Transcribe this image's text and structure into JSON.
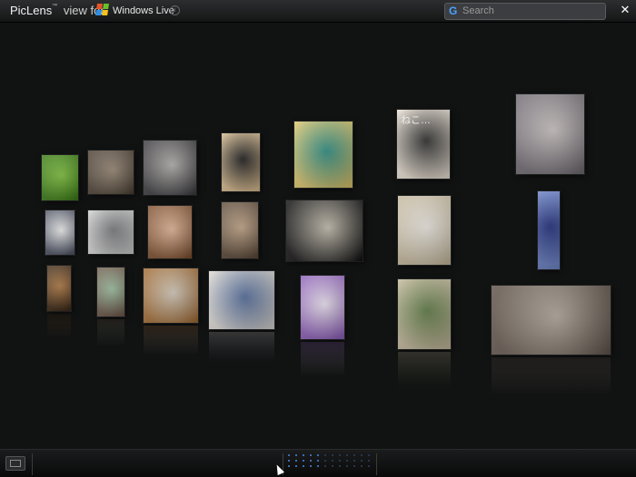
{
  "header": {
    "brand": "PicLens",
    "trademark": "™",
    "view_for": "view for",
    "provider_label": "Windows Live",
    "info_icon": "info-icon",
    "close_label": "✕"
  },
  "search": {
    "placeholder": "Search",
    "value": ""
  },
  "wall": {
    "captions": {
      "neko": "ねこ…"
    },
    "tiles": [
      {
        "id": "t1",
        "icon": "cat-on-grass-photo",
        "colors": [
          "#7fc33c",
          "#3a7a17"
        ]
      },
      {
        "id": "t2",
        "icon": "sleeping-kittens-photo",
        "colors": [
          "#9a8a77",
          "#4a3f33"
        ]
      },
      {
        "id": "t3",
        "icon": "tabby-cat-photo",
        "colors": [
          "#b7b4b0",
          "#3b3a3e"
        ]
      },
      {
        "id": "t4",
        "icon": "anime-text-screenshot",
        "colors": [
          "#1a1a1a",
          "#d5b98e"
        ]
      },
      {
        "id": "t5",
        "icon": "cartoon-cat-drawing",
        "colors": [
          "#2c8f85",
          "#d9c36b"
        ]
      },
      {
        "id": "t6",
        "icon": "neko-kitten-photo",
        "colors": [
          "#2b2b2b",
          "#e8dfd2"
        ]
      },
      {
        "id": "t7",
        "icon": "plush-cats-photo",
        "colors": [
          "#cfc8c6",
          "#6f6a72"
        ]
      },
      {
        "id": "t8",
        "icon": "cartoon-cat-figure",
        "colors": [
          "#f5f5f5",
          "#4f5566"
        ]
      },
      {
        "id": "t9",
        "icon": "gray-kitten-photo",
        "colors": [
          "#7a7b7e",
          "#cfcfcf"
        ]
      },
      {
        "id": "t10",
        "icon": "anime-poster",
        "colors": [
          "#e6b99a",
          "#7d4f2f"
        ]
      },
      {
        "id": "t11",
        "icon": "cat-by-window-photo",
        "colors": [
          "#c5a789",
          "#5b4a39"
        ]
      },
      {
        "id": "t12",
        "icon": "black-cat-photo",
        "colors": [
          "#c9c2b3",
          "#111"
        ]
      },
      {
        "id": "t13",
        "icon": "cat-sketch",
        "colors": [
          "#f0ece6",
          "#c5b89c"
        ]
      },
      {
        "id": "t14",
        "icon": "blue-text-strip",
        "colors": [
          "#1d2b7a",
          "#6f86c9"
        ]
      },
      {
        "id": "t15",
        "icon": "cat-in-box-photo",
        "colors": [
          "#b27a43",
          "#3e2a18"
        ]
      },
      {
        "id": "t16",
        "icon": "cat-in-bucket-photo",
        "colors": [
          "#9fc2a3",
          "#6f5a4b"
        ]
      },
      {
        "id": "t17",
        "icon": "ginger-cat-photo",
        "colors": [
          "#d8cfc0",
          "#a06a33"
        ]
      },
      {
        "id": "t18",
        "icon": "kittens-lounging-photo",
        "colors": [
          "#536d9e",
          "#d8d5d0"
        ]
      },
      {
        "id": "t19",
        "icon": "anime-girl-illustration",
        "colors": [
          "#f0e8f5",
          "#8d5fb8"
        ]
      },
      {
        "id": "t20",
        "icon": "cat-on-rock-photo",
        "colors": [
          "#5e7b43",
          "#c2b79b"
        ]
      },
      {
        "id": "t21",
        "icon": "cats-cuddling-photo",
        "colors": [
          "#b6aca0",
          "#5d5148"
        ]
      }
    ]
  },
  "footer": {
    "fullscreen_icon": "fullscreen-icon",
    "page_dots_total": 36,
    "page_dots_active": 15
  }
}
